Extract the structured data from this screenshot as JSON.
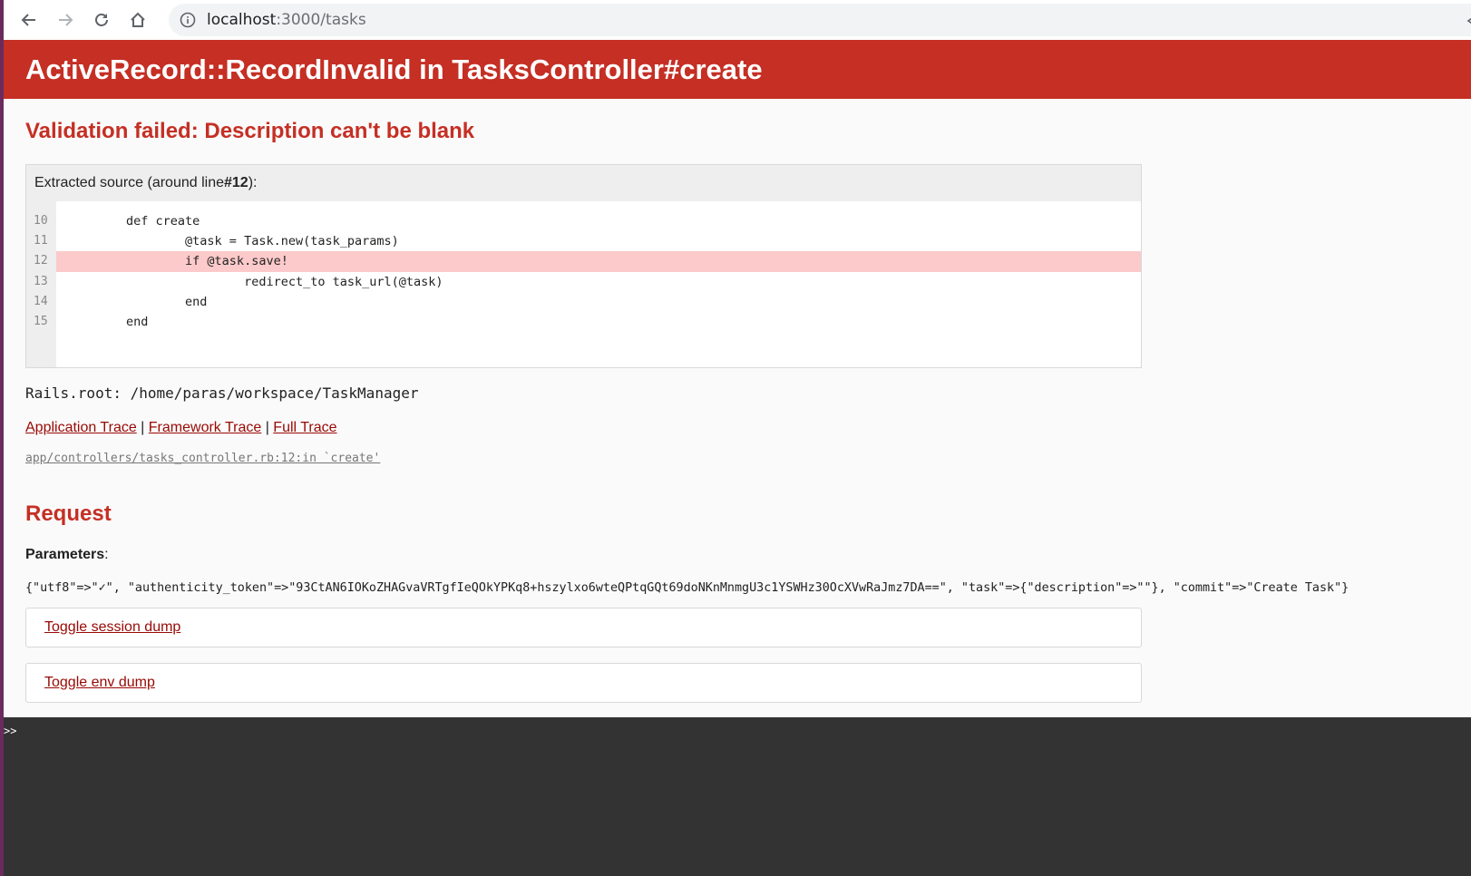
{
  "browser": {
    "url_host": "localhost",
    "url_path": ":3000/tasks"
  },
  "error": {
    "title": "ActiveRecord::RecordInvalid in TasksController#create",
    "message": "Validation failed: Description can't be blank"
  },
  "source": {
    "header_prefix": "Extracted source (around line ",
    "header_line": "#12",
    "header_suffix": "):",
    "lines": [
      {
        "num": "10",
        "code": "        def create"
      },
      {
        "num": "11",
        "code": "                @task = Task.new(task_params)"
      },
      {
        "num": "12",
        "code": "                if @task.save!"
      },
      {
        "num": "13",
        "code": "                        redirect_to task_url(@task)"
      },
      {
        "num": "14",
        "code": "                end"
      },
      {
        "num": "15",
        "code": "        end"
      }
    ]
  },
  "rails_root": "Rails.root: /home/paras/workspace/TaskManager",
  "trace": {
    "application": "Application Trace",
    "framework": "Framework Trace",
    "full": "Full Trace",
    "separator": " | ",
    "line": "app/controllers/tasks_controller.rb:12:in `create'"
  },
  "request": {
    "title": "Request",
    "params_label": "Parameters",
    "params_colon": ":",
    "params_value": "{\"utf8\"=>\"✓\", \"authenticity_token\"=>\"93CtAN6IOKoZHAGvaVRTgfIeQOkYPKq8+hszylxo6wteQPtqGQt69doNKnMnmgU3c1YSWHz30OcXVwRaJmz7DA==\", \"task\"=>{\"description\"=>\"\"}, \"commit\"=>\"Create Task\"}"
  },
  "toggles": {
    "session": "Toggle session dump",
    "env": "Toggle env dump"
  },
  "console": {
    "prompt": ">>"
  }
}
